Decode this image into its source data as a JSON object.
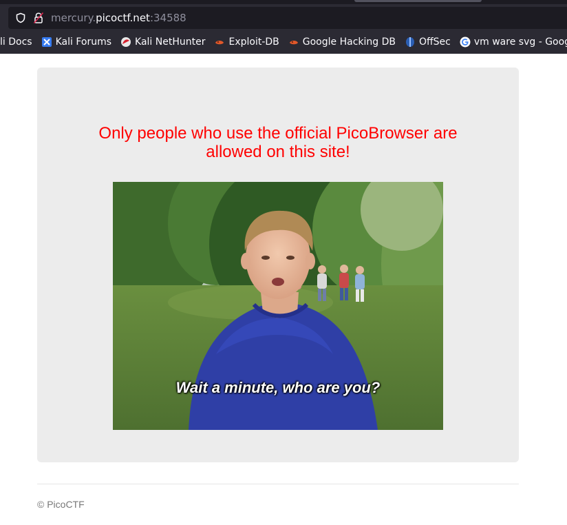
{
  "browser": {
    "url": {
      "subdomain": "mercury.",
      "domain": "picoctf.net",
      "port": ":34588"
    },
    "bookmarks": [
      {
        "label": "li Docs",
        "icon": "kali-docs-icon"
      },
      {
        "label": "Kali Forums",
        "icon": "kali-forums-icon"
      },
      {
        "label": "Kali NetHunter",
        "icon": "kali-nethunter-icon"
      },
      {
        "label": "Exploit-DB",
        "icon": "exploit-db-icon"
      },
      {
        "label": "Google Hacking DB",
        "icon": "google-hacking-db-icon"
      },
      {
        "label": "OffSec",
        "icon": "offsec-icon"
      },
      {
        "label": "vm ware svg - Google …",
        "icon": "google-icon"
      }
    ]
  },
  "page": {
    "message_line1": "Only people who use the official PicoBrowser are",
    "message_line2": "allowed on this site!",
    "image_caption": "Wait a minute, who are you?",
    "footer": "© PicoCTF"
  },
  "colors": {
    "message": "#ff0000",
    "panel": "#ececec",
    "footer_text": "#777777"
  }
}
